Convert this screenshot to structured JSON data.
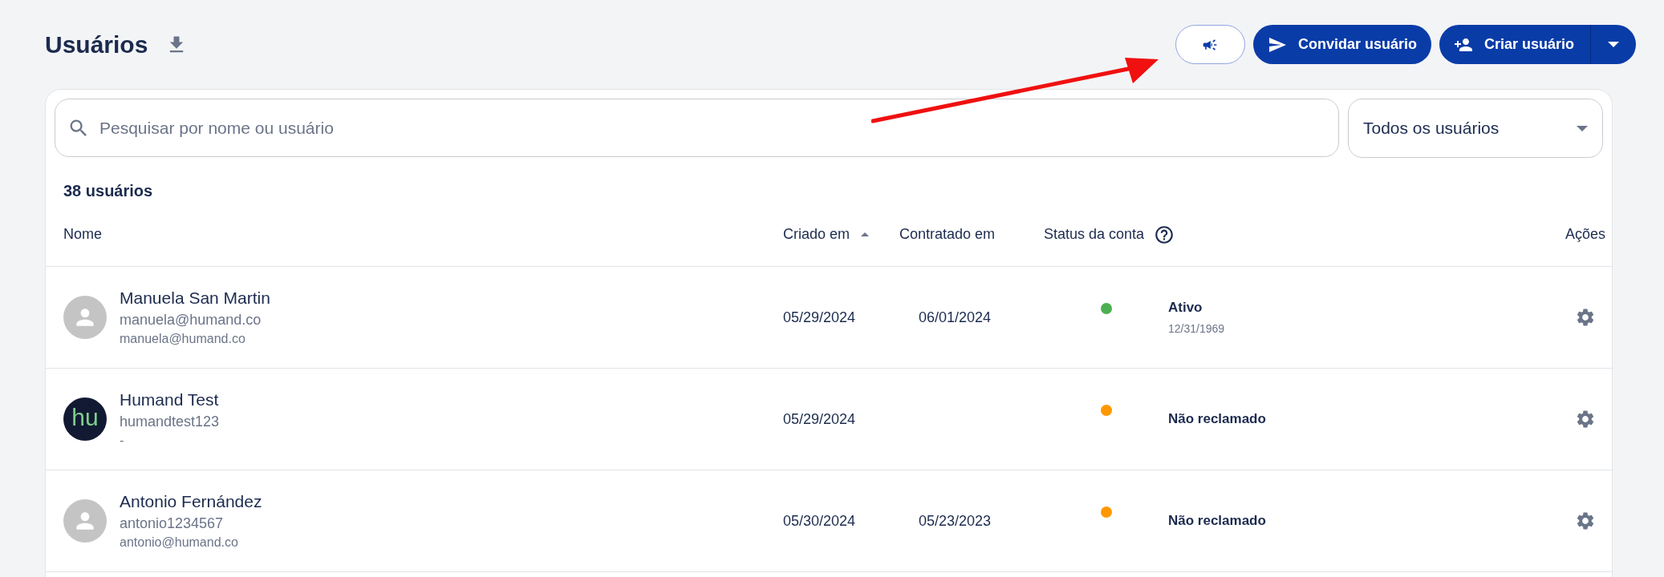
{
  "header": {
    "title": "Usuários",
    "buttons": [
      {
        "kind": "announce"
      },
      {
        "kind": "invite",
        "label": "Convidar usuário"
      },
      {
        "kind": "create",
        "label": "Criar usuário"
      }
    ]
  },
  "search": {
    "placeholder": "Pesquisar por nome ou usuário"
  },
  "filter": {
    "value": "Todos os usuários"
  },
  "count": "38 usuários",
  "table": {
    "columns": [
      {
        "label": "Nome",
        "sorted": false
      },
      {
        "label": "Criado em",
        "sorted": true
      },
      {
        "label": "Contratado em",
        "sorted": false
      },
      {
        "label": "Status da conta",
        "sorted": false
      },
      {
        "label": "Ações",
        "sorted": false
      }
    ],
    "rows": [
      {
        "name": "Manuela San Martin",
        "username": "manuela@humand.co",
        "email": "manuela@humand.co",
        "avatar": {
          "kind": "placeholder"
        },
        "created": "05/29/2024",
        "hired": "06/01/2024",
        "status": "Ativo",
        "status_date": "12/31/1969",
        "color": "#4caf50"
      },
      {
        "name": "Humand Test",
        "username": "humandtest123",
        "email": "-",
        "avatar": {
          "kind": "logo",
          "text": "hu"
        },
        "created": "05/29/2024",
        "status": "Não reclamado",
        "color": "#ff9800"
      },
      {
        "name": "Antonio Fernández",
        "username": "antonio1234567",
        "email": "antonio@humand.co",
        "avatar": {
          "kind": "placeholder"
        },
        "created": "05/30/2024",
        "hired": "05/23/2023",
        "status": "Não reclamado",
        "color": "#ff9800"
      }
    ]
  }
}
